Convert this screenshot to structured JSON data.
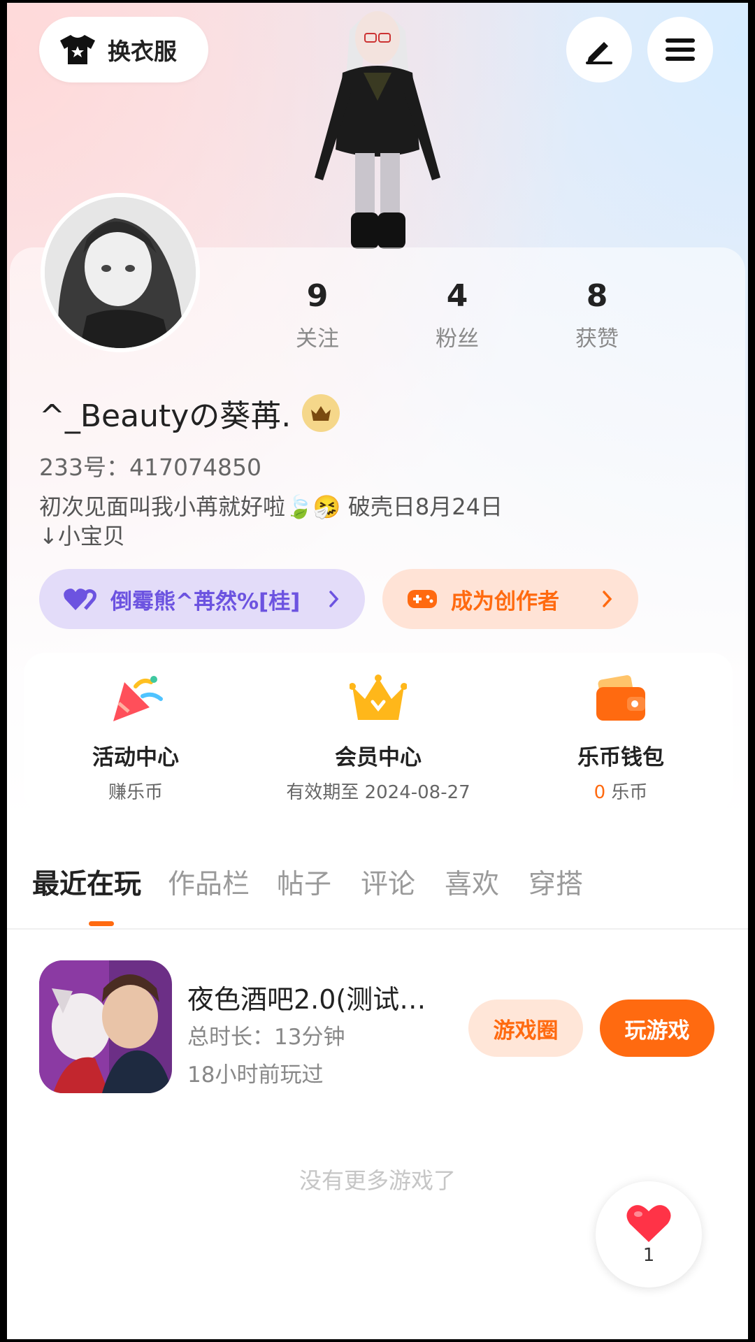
{
  "topbar": {
    "outfit_label": "换衣服",
    "outfit_icon": "tshirt-icon",
    "edit_icon": "pen-icon",
    "menu_icon": "hamburger-icon"
  },
  "stats": [
    {
      "num": "9",
      "label": "关注"
    },
    {
      "num": "4",
      "label": "粉丝"
    },
    {
      "num": "8",
      "label": "获赞"
    }
  ],
  "profile": {
    "nickname": "^_Beautyの葵苒.",
    "uid": "233号：417074850",
    "bio_line1": "初次见面叫我小苒就好啦🍃🤧 破壳日8月24日",
    "bio_line2": "↓小宝贝"
  },
  "pills": {
    "bear_label": "倒霉熊^苒然%[桂]",
    "creator_label": "成为创作者"
  },
  "quick": [
    {
      "title": "活动中心",
      "sub": "赚乐币"
    },
    {
      "title": "会员中心",
      "sub": "有效期至 2024-08-27"
    },
    {
      "title": "乐币钱包",
      "sub_num": "0",
      "sub_unit": " 乐币"
    }
  ],
  "tabs": [
    "最近在玩",
    "作品栏",
    "帖子",
    "评论",
    "喜欢",
    "穿搭"
  ],
  "game": {
    "title": "夜色酒吧2.0(测试…",
    "duration": "总时长：13分钟",
    "last_played": "18小时前玩过",
    "circle_label": "游戏圈",
    "play_label": "玩游戏"
  },
  "footer_text": "没有更多游戏了",
  "likes_count": "1",
  "colors": {
    "accent": "#ff6a10",
    "purple": "#6c53e0"
  }
}
